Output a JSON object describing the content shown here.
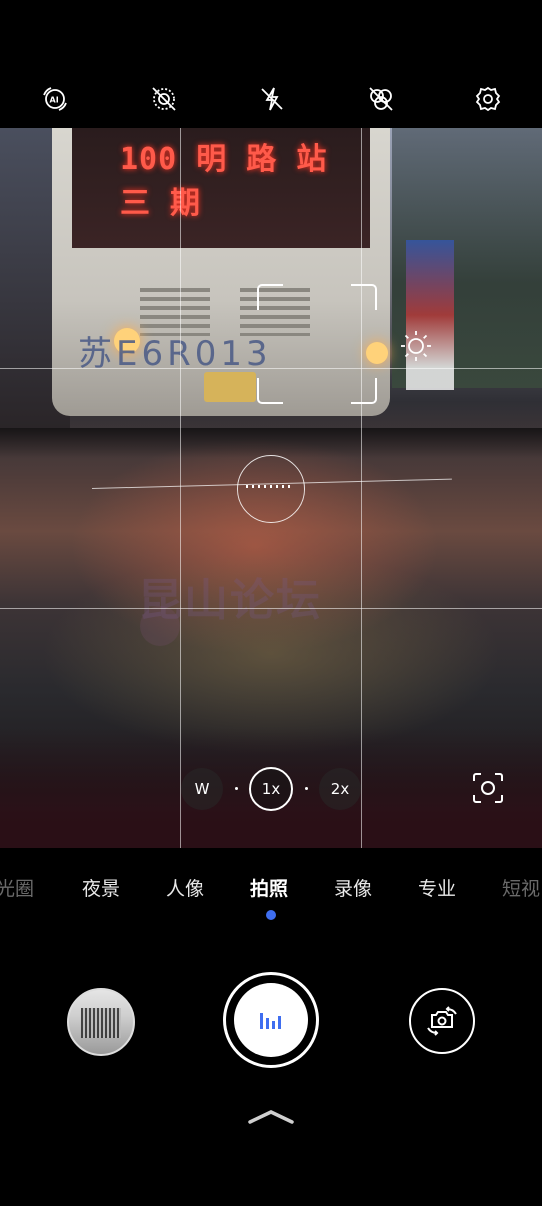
{
  "top_bar": {
    "icons": [
      "ai-icon",
      "hdr-off-icon",
      "flash-off-icon",
      "filter-off-icon",
      "settings-icon"
    ]
  },
  "viewfinder": {
    "bus_display_text": "100 明 路 站 三 期",
    "plate_text": "苏E6R013",
    "watermark_text": "昆山论坛"
  },
  "zoom": {
    "wide_label": "W",
    "current_label": "1x",
    "tele_label": "2x"
  },
  "modes": {
    "items": [
      "光圈",
      "夜景",
      "人像",
      "拍照",
      "录像",
      "专业",
      "短视"
    ],
    "active": "拍照"
  },
  "colors": {
    "accent": "#3f6ef0",
    "background": "#000000"
  }
}
